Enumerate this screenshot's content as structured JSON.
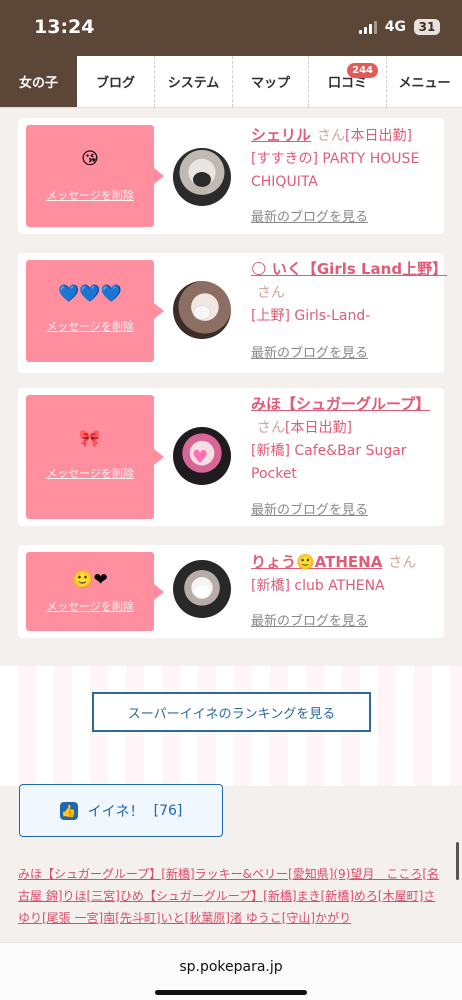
{
  "status": {
    "time": "13:24",
    "network": "4G",
    "battery": "31"
  },
  "nav": {
    "tabs": [
      {
        "label": "女の子",
        "active": true
      },
      {
        "label": "ブログ"
      },
      {
        "label": "システム"
      },
      {
        "label": "マップ"
      },
      {
        "label": "口コミ",
        "badge": "244"
      },
      {
        "label": "メニュー"
      }
    ]
  },
  "messages": [
    {
      "emoji": "😘",
      "delete_label": "メッセージを削除",
      "name": "シェリル",
      "san": "さん",
      "status": "[本日出勤]",
      "shop": "[すすきの] PARTY HOUSE CHIQUITA",
      "blog_link": "最新のブログを見る"
    },
    {
      "emoji": "💙💙💙",
      "delete_label": "メッセージを削除",
      "name": "🌕 いく【Girls Land上野】",
      "san": "さん",
      "status": "",
      "shop": "[上野] Girls-Land-",
      "blog_link": "最新のブログを見る"
    },
    {
      "emoji": "🎀",
      "delete_label": "メッセージを削除",
      "name": "みほ【シュガーグループ】",
      "san": "さん",
      "status": "[本日出勤]",
      "shop": "[新橋] Cafe&Bar Sugar Pocket",
      "blog_link": "最新のブログを見る"
    },
    {
      "emoji": "🙂❤",
      "delete_label": "メッセージを削除",
      "name": "りょう🙂ATHENA",
      "san": "さん",
      "status": "",
      "shop": "[新橋] club ATHENA",
      "blog_link": "最新のブログを見る"
    }
  ],
  "ranking_button": "スーパーイイネのランキングを見る",
  "like": {
    "label": "イイネ！",
    "count": "[76]"
  },
  "related_links": [
    "みほ【シュガーグループ】[新橋]",
    "ラッキー&ベリー[愛知県](9)",
    "望月　こころ[名古屋 錦]",
    "りほ[三宮]",
    "ひめ【シュガーグループ】[新橋]",
    "まき[新橋]",
    "めろ[木屋町]",
    "さゆり[尾張 一宮]",
    "南[先斗町]",
    "いと[秋葉原]",
    "渚 ゆうこ[守山]",
    "かがり"
  ],
  "browser": {
    "url": "sp.pokepara.jp"
  },
  "colors": {
    "nav_active": "#5b4638",
    "accent": "#e15a76",
    "pink": "#ff8e9f",
    "link_blue": "#1e67b1"
  }
}
